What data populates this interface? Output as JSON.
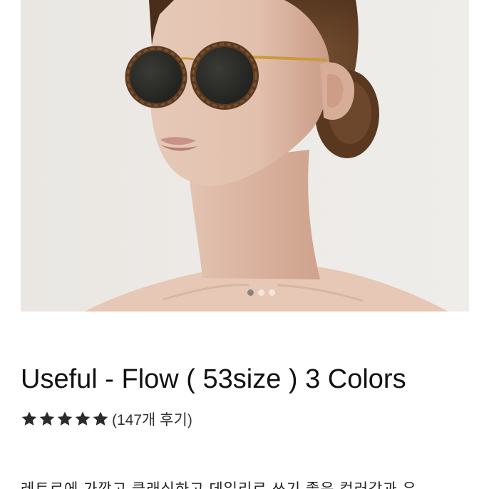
{
  "product": {
    "title": "Useful - Flow ( 53size ) 3 Colors",
    "rating_stars": 5,
    "review_count_text": "(147개 후기)",
    "description_peek": "레트로에 가깝고 클래식하고 데일리로 쓰기 좋은 컬러감과 우"
  },
  "carousel": {
    "image_icon": "model-wearing-round-sunglasses-photo",
    "slide_count": 3,
    "active_index": 0
  },
  "colors": {
    "background": "#ffffff",
    "hero_bg": "#ece9e5",
    "star": "#2b2b2b",
    "title": "#111111"
  }
}
